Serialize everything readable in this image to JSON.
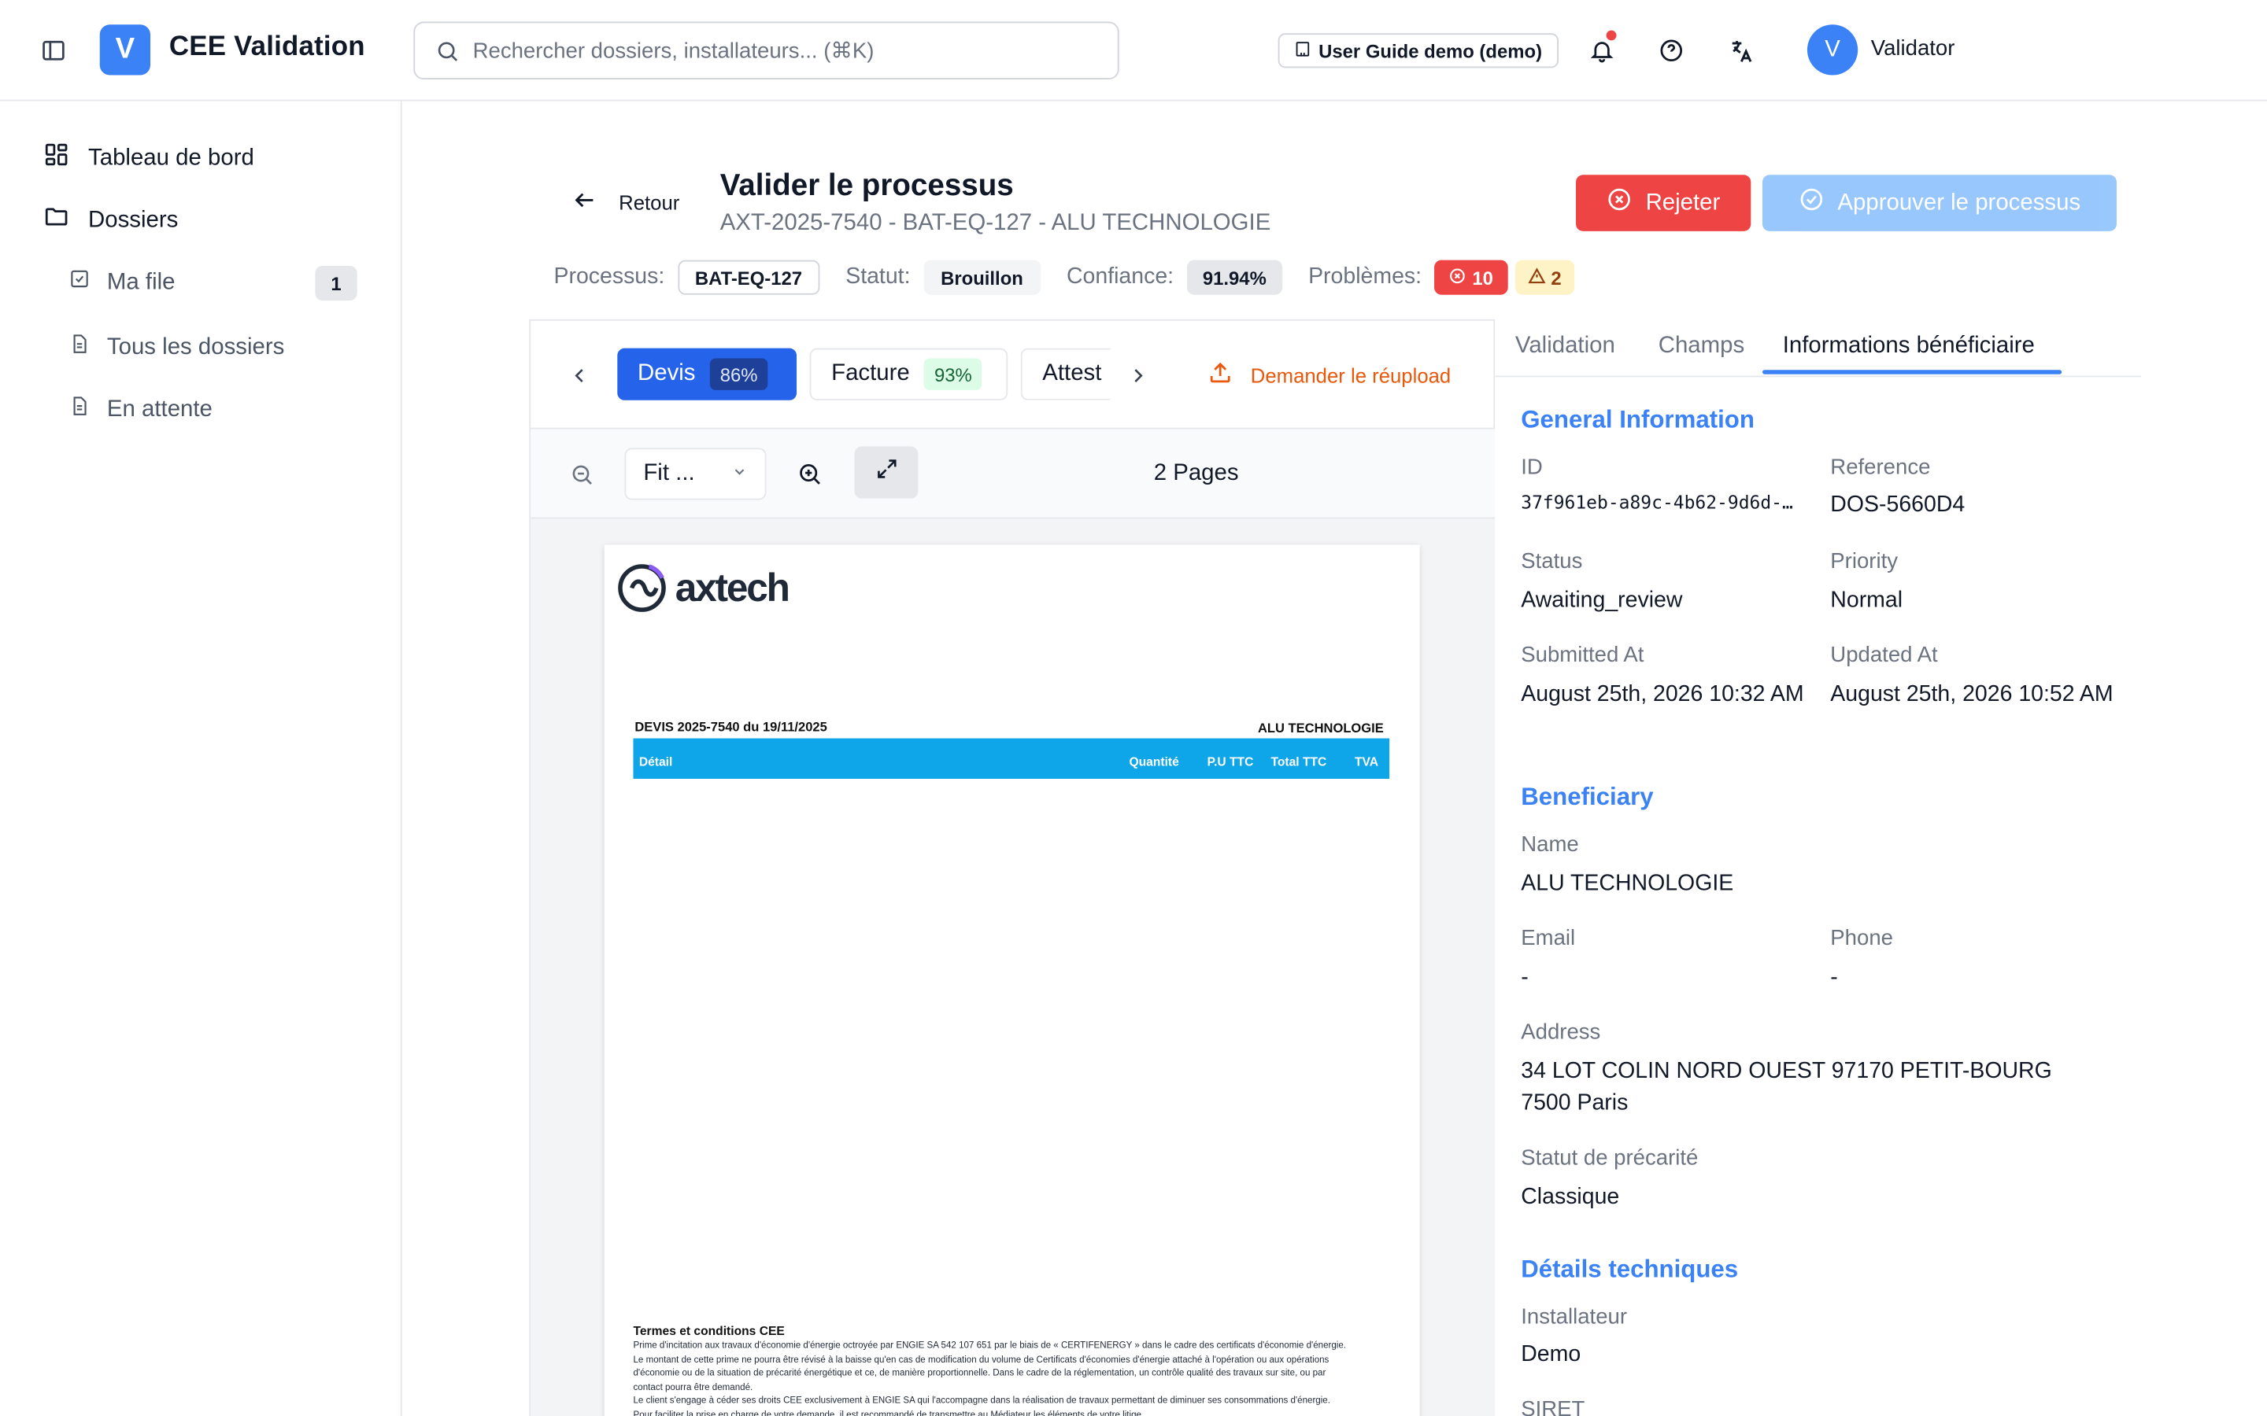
{
  "header": {
    "app_initial": "V",
    "app_title": "CEE Validation",
    "search_placeholder": "Rechercher dossiers, installateurs... (⌘K)",
    "guide_label": "User Guide demo (demo)",
    "user_initial": "V",
    "user_name": "Validator"
  },
  "sidebar": {
    "items": [
      {
        "label": "Tableau de bord",
        "icon": "dashboard-icon"
      },
      {
        "label": "Dossiers",
        "icon": "folder-icon"
      }
    ],
    "sub_items": [
      {
        "label": "Ma file",
        "icon": "check-square-icon",
        "count": "1"
      },
      {
        "label": "Tous les dossiers",
        "icon": "file-icon"
      },
      {
        "label": "En attente",
        "icon": "file-icon"
      }
    ]
  },
  "page": {
    "back_label": "Retour",
    "title": "Valider le processus",
    "subtitle": "AXT-2025-7540 - BAT-EQ-127 - ALU TECHNOLOGIE",
    "reject_label": "Rejeter",
    "approve_label": "Approuver le processus"
  },
  "meta": {
    "process_label": "Processus:",
    "process_value": "BAT-EQ-127",
    "status_label": "Statut:",
    "status_value": "Brouillon",
    "confidence_label": "Confiance:",
    "confidence_value": "91.94%",
    "problems_label": "Problèmes:",
    "errors_count": "10",
    "warnings_count": "2"
  },
  "documents": {
    "tabs": [
      {
        "label": "Devis",
        "pct": "86%"
      },
      {
        "label": "Facture",
        "pct": "93%"
      },
      {
        "label": "Attest"
      }
    ],
    "reupload_label": "Demander le réupload",
    "zoom_value": "Fit ...",
    "pages_count": "2 Pages"
  },
  "pdf": {
    "logo_text": "axtech",
    "devis_title": "DEVIS 2025-7540 du 19/11/2025",
    "client": "ALU TECHNOLOGIE",
    "columns": {
      "detail": "Détail",
      "qty": "Quantité",
      "pu": "P.U TTC",
      "total": "Total TTC",
      "tva": "TVA"
    },
    "terms_title": "Termes et conditions CEE",
    "terms_lines": [
      "Prime d'incitation aux travaux d'économie d'énergie octroyée par ENGIE SA 542 107 651 par le biais de « CERTIFENERGY » dans le cadre des certificats d'économie d'énergie.",
      "Le montant de cette prime ne pourra être révisé à la baisse qu'en cas de modification du volume de Certificats d'économies d'énergie attaché à l'opération ou aux opérations",
      "d'économie ou de la situation de précarité énergétique et ce, de manière proportionnelle. Dans le cadre de la réglementation, un contrôle qualité des travaux sur site, ou par",
      "contact pourra être demandé.",
      "Le client s'engage à céder ses droits CEE exclusivement à ENGIE SA qui l'accompagne dans la réalisation de travaux permettant de diminuer ses consommations d'énergie.",
      "Pour faciliter la prise en charge de votre demande, il est recommandé de transmettre au Médiateur les éléments de votre litige."
    ]
  },
  "panel": {
    "tabs": [
      "Validation",
      "Champs",
      "Informations bénéficiaire"
    ],
    "general": {
      "title": "General Information",
      "id_label": "ID",
      "id_value": "37f961eb-a89c-4b62-9d6d-…",
      "reference_label": "Reference",
      "reference_value": "DOS-5660D4",
      "status_label": "Status",
      "status_value": "Awaiting_review",
      "priority_label": "Priority",
      "priority_value": "Normal",
      "submitted_label": "Submitted At",
      "submitted_value": "August 25th, 2026 10:32 AM",
      "updated_label": "Updated At",
      "updated_value": "August 25th, 2026 10:52 AM"
    },
    "beneficiary": {
      "title": "Beneficiary",
      "name_label": "Name",
      "name_value": "ALU TECHNOLOGIE",
      "email_label": "Email",
      "email_value": "-",
      "phone_label": "Phone",
      "phone_value": "-",
      "address_label": "Address",
      "address_value": "34 LOT COLIN NORD OUEST 97170 PETIT-BOURG 7500 Paris",
      "precarity_label": "Statut de précarité",
      "precarity_value": "Classique"
    },
    "technical": {
      "title": "Détails techniques",
      "installer_label": "Installateur",
      "installer_value": "Demo",
      "siret_label": "SIRET"
    }
  },
  "colors": {
    "accent": "#3b82f6",
    "primary_tab": "#2563eb",
    "danger": "#ef4444",
    "warning_bg": "#fef3c7",
    "reupload": "#ea580c",
    "pdf_table_header": "#0ea5e9"
  }
}
